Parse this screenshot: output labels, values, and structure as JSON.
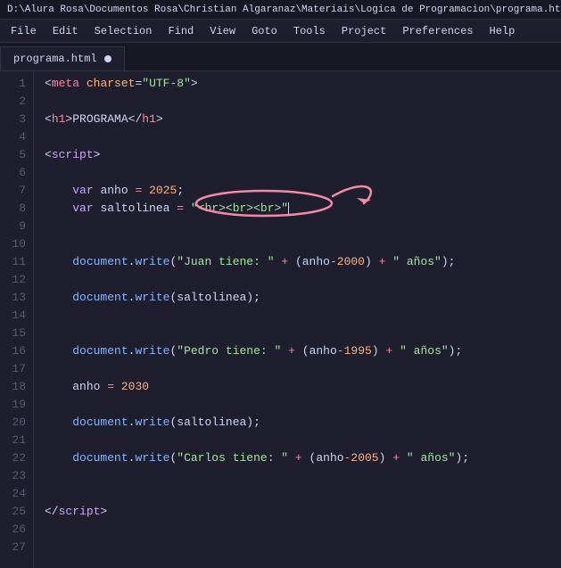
{
  "titleBar": {
    "text": "D:\\Alura Rosa\\Documentos Rosa\\Christian Algaranaz\\Materiais\\Logica de Programacion\\programa.html • - Sub"
  },
  "menuBar": {
    "items": [
      "File",
      "Edit",
      "Selection",
      "Find",
      "View",
      "Goto",
      "Tools",
      "Project",
      "Preferences",
      "Help"
    ]
  },
  "tab": {
    "name": "programa.html",
    "modified": true
  },
  "lines": [
    {
      "num": "1",
      "content": "meta_charset"
    },
    {
      "num": "2",
      "content": "empty"
    },
    {
      "num": "3",
      "content": "h1_programa"
    },
    {
      "num": "4",
      "content": "empty"
    },
    {
      "num": "5",
      "content": "script_open"
    },
    {
      "num": "6",
      "content": "empty"
    },
    {
      "num": "7",
      "content": "var_anho"
    },
    {
      "num": "8",
      "content": "var_saltolinea"
    },
    {
      "num": "9",
      "content": "empty"
    },
    {
      "num": "10",
      "content": "empty"
    },
    {
      "num": "11",
      "content": "doc_write_juan"
    },
    {
      "num": "12",
      "content": "empty"
    },
    {
      "num": "13",
      "content": "doc_write_salto1"
    },
    {
      "num": "14",
      "content": "empty"
    },
    {
      "num": "15",
      "content": "empty"
    },
    {
      "num": "16",
      "content": "doc_write_pedro"
    },
    {
      "num": "17",
      "content": "empty"
    },
    {
      "num": "18",
      "content": "anho_assign"
    },
    {
      "num": "19",
      "content": "empty"
    },
    {
      "num": "20",
      "content": "doc_write_salto2"
    },
    {
      "num": "21",
      "content": "empty"
    },
    {
      "num": "22",
      "content": "doc_write_carlos"
    },
    {
      "num": "23",
      "content": "empty"
    },
    {
      "num": "24",
      "content": "empty"
    },
    {
      "num": "25",
      "content": "script_close"
    },
    {
      "num": "26",
      "content": "empty"
    },
    {
      "num": "27",
      "content": "empty"
    }
  ]
}
